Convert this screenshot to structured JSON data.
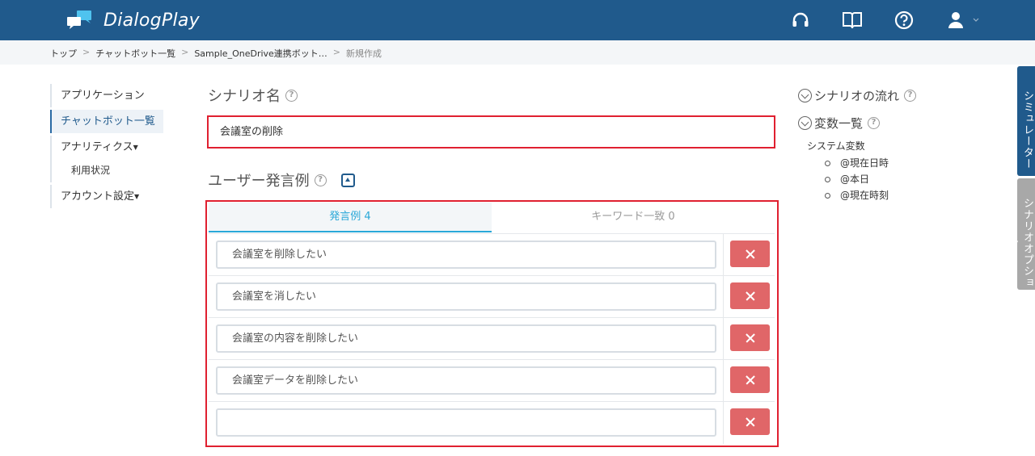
{
  "app": {
    "name": "DialogPlay"
  },
  "breadcrumb": {
    "items": [
      "トップ",
      "チャットボット一覧",
      "Sample_OneDrive連携ボット…",
      "新規作成"
    ],
    "separator": ">"
  },
  "sidebar": {
    "items": [
      {
        "label": "アプリケーション"
      },
      {
        "label": "チャットボット一覧",
        "active": true
      },
      {
        "label": "アナリティクス"
      },
      {
        "label": "利用状況"
      },
      {
        "label": "アカウント設定"
      }
    ]
  },
  "scenario": {
    "name_label": "シナリオ名",
    "name_value": "会議室の削除",
    "examples_label": "ユーザー発言例"
  },
  "tabs": [
    {
      "label": "発言例 4",
      "active": true
    },
    {
      "label": "キーワード一致 0",
      "active": false
    }
  ],
  "utterances": [
    "会議室を削除したい",
    "会議室を消したい",
    "会議室の内容を削除したい",
    "会議室データを削除したい",
    ""
  ],
  "right_panel": {
    "flow_label": "シナリオの流れ",
    "vars_label": "変数一覧",
    "system_vars_label": "システム変数",
    "system_vars": [
      "@現在日時",
      "@本日",
      "@現在時刻"
    ]
  },
  "side_tabs": {
    "simulator": "シミュレーター",
    "options": "シナリオオプション"
  },
  "icons": {
    "header": [
      "headset-icon",
      "book-icon",
      "help-circle-icon",
      "user-icon",
      "chevron-down-icon"
    ],
    "help": "question-circle-icon",
    "delete": "close-icon"
  },
  "colors": {
    "header": "#205a8c",
    "accent": "#2aa8d8",
    "delete": "#e06668",
    "highlight": "#e02030"
  }
}
